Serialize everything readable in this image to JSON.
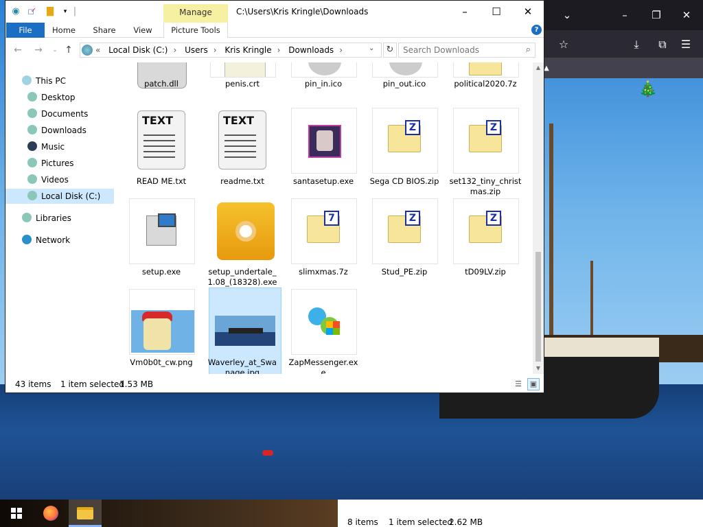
{
  "explorer": {
    "title_path": "C:\\Users\\Kris Kringle\\Downloads",
    "context_tab": "Manage",
    "tabs": [
      "File",
      "Home",
      "Share",
      "View",
      "Picture Tools"
    ],
    "address": {
      "prefix": "«",
      "crumbs": [
        "Local Disk (C:)",
        "Users",
        "Kris Kringle",
        "Downloads"
      ]
    },
    "search_placeholder": "Search Downloads",
    "nav": [
      {
        "label": "This PC",
        "icon": "pc-icon"
      },
      {
        "label": "Desktop",
        "icon": "desktop-icon"
      },
      {
        "label": "Documents",
        "icon": "documents-icon"
      },
      {
        "label": "Downloads",
        "icon": "downloads-icon"
      },
      {
        "label": "Music",
        "icon": "music-icon"
      },
      {
        "label": "Pictures",
        "icon": "pictures-icon"
      },
      {
        "label": "Videos",
        "icon": "videos-icon"
      },
      {
        "label": "Local Disk (C:)",
        "icon": "disk-icon"
      },
      {
        "label": "Libraries",
        "icon": "libraries-icon"
      },
      {
        "label": "Network",
        "icon": "network-icon"
      }
    ],
    "selected_nav": "Local Disk (C:)",
    "files": [
      {
        "name": "patch.dll",
        "icon": "dll-icon"
      },
      {
        "name": "penis.crt",
        "icon": "certificate-icon"
      },
      {
        "name": "pin_in.ico",
        "icon": "ico-file-icon"
      },
      {
        "name": "pin_out.ico",
        "icon": "ico-file-icon"
      },
      {
        "name": "political2020.7z",
        "icon": "archive-icon"
      },
      {
        "name": "READ ME.txt",
        "icon": "text-file-icon"
      },
      {
        "name": "readme.txt",
        "icon": "text-file-icon"
      },
      {
        "name": "santasetup.exe",
        "icon": "santa-exe-icon"
      },
      {
        "name": "Sega CD BIOS.zip",
        "icon": "zip-icon"
      },
      {
        "name": "set132_tiny_christmas.zip",
        "icon": "zip-icon"
      },
      {
        "name": "setup.exe",
        "icon": "installer-icon"
      },
      {
        "name": "setup_undertale_1.08_(18328).exe",
        "icon": "disc-installer-icon"
      },
      {
        "name": "slimxmas.7z",
        "icon": "7z-icon"
      },
      {
        "name": "Stud_PE.zip",
        "icon": "zip-icon"
      },
      {
        "name": "tD09LV.zip",
        "icon": "zip-icon"
      },
      {
        "name": "Vm0b0t_cw.png",
        "icon": "image-thumbnail"
      },
      {
        "name": "Waverley_at_Swanage.jpg",
        "icon": "image-thumbnail"
      },
      {
        "name": "ZapMessenger.exe",
        "icon": "messenger-icon"
      }
    ],
    "text_icon_label": "TEXT",
    "zip_letter": "Z",
    "sevenz_letter": "7",
    "selected_file": "Waverley_at_Swanage.jpg",
    "status": {
      "items": "43 items",
      "selection": "1 item selected",
      "size": "1.53 MB"
    }
  },
  "background_explorer_status": {
    "items": "8 items",
    "selection": "1 item selected",
    "size": "2.62 MB"
  },
  "colors": {
    "accent": "#1a6fc4",
    "selection": "#cce8ff",
    "manage_tab": "#f6f1a2"
  }
}
